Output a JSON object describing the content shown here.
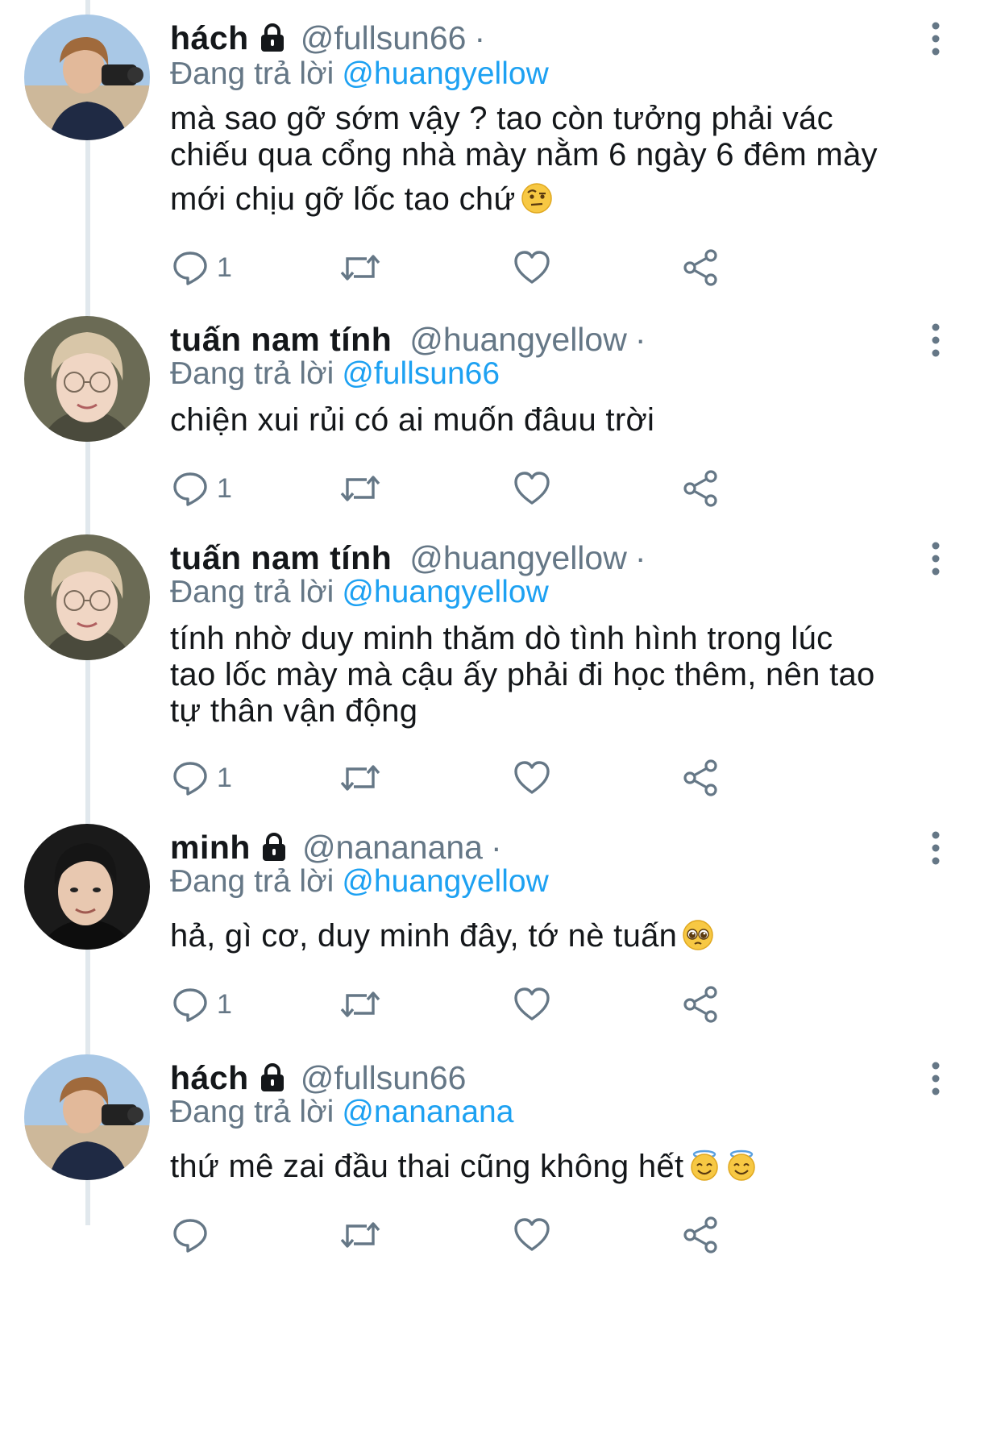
{
  "colors": {
    "link": "#1da1f2",
    "secondary": "#657786",
    "primary_text": "#14171a",
    "thread_line": "#e1e8ed"
  },
  "icons": {
    "reply": "reply-icon",
    "retweet": "retweet-icon",
    "like": "heart-icon",
    "share": "share-icon",
    "more": "more-vertical-icon",
    "lock": "lock-icon"
  },
  "tweets": [
    {
      "name": "hách",
      "locked": true,
      "handle": "@fullsun66",
      "dot": "·",
      "reply_prefix": "Đang trả lời",
      "reply_to": "@huangyellow",
      "lines": [
        "mà sao gỡ sớm vậy ? tao còn tưởng phải vác",
        "chiếu qua cổng nhà mày nằm 6 ngày 6 đêm mày",
        "mới chịu gỡ lốc tao chứ"
      ],
      "emojis": [
        "raised-eyebrow-emoji"
      ],
      "reply_count": "1"
    },
    {
      "name": "tuấn nam tính",
      "locked": false,
      "handle": "@huangyellow",
      "dot": "·",
      "reply_prefix": "Đang trả lời",
      "reply_to": "@fullsun66",
      "lines": [
        "chiện xui rủi có ai muốn đâuu trời"
      ],
      "emojis": [],
      "reply_count": "1"
    },
    {
      "name": "tuấn nam tính",
      "locked": false,
      "handle": "@huangyellow",
      "dot": "·",
      "reply_prefix": "Đang trả lời",
      "reply_to": "@huangyellow",
      "lines": [
        "tính nhờ duy minh thăm dò tình hình trong lúc",
        "tao lốc mày mà cậu ấy phải đi học thêm, nên tao",
        "tự thân vận động"
      ],
      "emojis": [],
      "reply_count": "1"
    },
    {
      "name": "minh",
      "locked": true,
      "handle": "@nananana",
      "dot": "·",
      "reply_prefix": "Đang trả lời",
      "reply_to": "@huangyellow",
      "lines": [
        "hả, gì cơ, duy minh đây, tớ nè tuấn"
      ],
      "emojis": [
        "pleading-face-emoji"
      ],
      "reply_count": "1"
    },
    {
      "name": "hách",
      "locked": true,
      "handle": "@fullsun66",
      "dot": "",
      "reply_prefix": "Đang trả lời",
      "reply_to": "@nananana",
      "lines": [
        "thứ mê zai đầu thai cũng không hết"
      ],
      "emojis": [
        "smiling-face-with-halo-emoji",
        "smiling-face-with-halo-emoji"
      ],
      "reply_count": ""
    }
  ]
}
